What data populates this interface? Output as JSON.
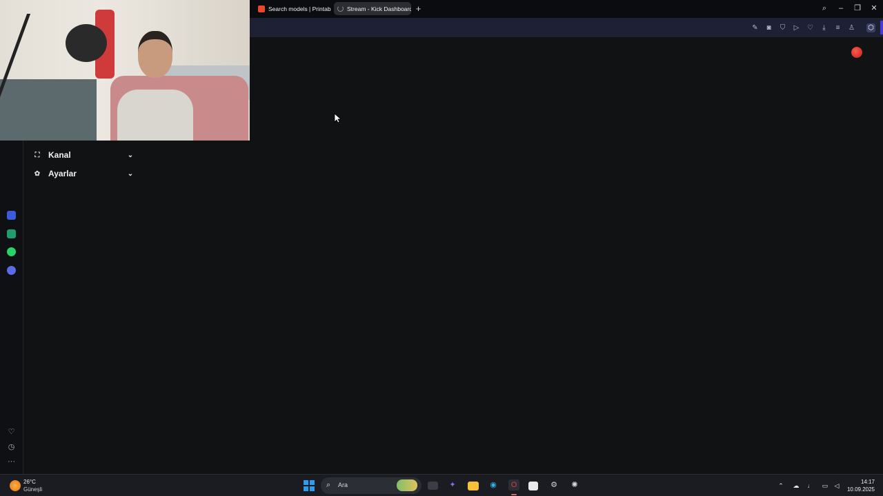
{
  "browser": {
    "tabs": [
      {
        "title": "Search models | Printables",
        "active": false
      },
      {
        "title": "Stream - Kick Dashboard",
        "active": true
      }
    ],
    "new_tab_icon": "plus-icon",
    "window_controls": [
      "search-icon",
      "minimize-icon",
      "restore-icon",
      "close-icon"
    ],
    "toolbar_icons": [
      "edit-icon",
      "camera-icon",
      "shield-icon",
      "play-icon",
      "heart-icon",
      "download-icon",
      "menu-icon",
      "user-icon",
      "cube-icon"
    ]
  },
  "left_rail": {
    "apps": [
      {
        "name": "aria-icon",
        "color": "#3b5bdb"
      },
      {
        "name": "chatgpt-icon",
        "color": "#1f9d6f"
      },
      {
        "name": "whatsapp-icon",
        "color": "#25d366"
      },
      {
        "name": "player-icon",
        "color": "#5b6be8"
      }
    ],
    "bottom_icons": [
      "heart-icon",
      "history-icon",
      "more-icon"
    ]
  },
  "dashboard_menu": {
    "items": [
      {
        "label": "Kanal",
        "icon": "channel-icon"
      },
      {
        "label": "Ayarlar",
        "icon": "settings-icon"
      }
    ]
  },
  "taskbar": {
    "weather": {
      "temp": "26°C",
      "desc": "Güneşli"
    },
    "search_placeholder": "Ara",
    "clock": {
      "time": "14:17",
      "date": "10.09.2025"
    }
  },
  "colors": {
    "accent": "#4a3bd6",
    "background": "#111213",
    "toolbar": "#1e2133"
  }
}
